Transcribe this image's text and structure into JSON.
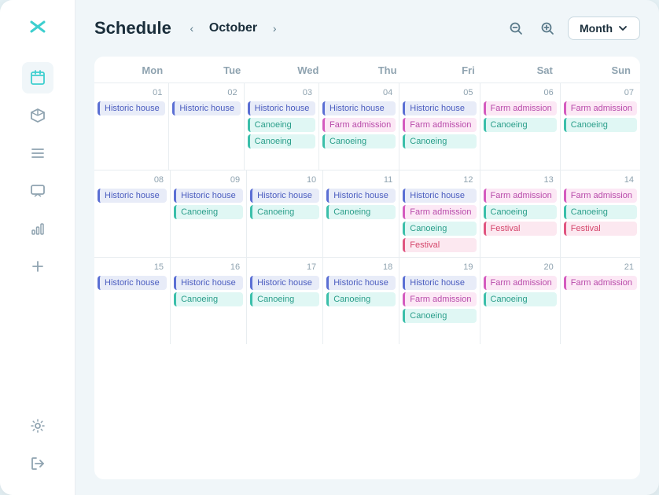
{
  "app": {
    "logo": "✕",
    "title": "Schedule",
    "current_month": "October",
    "view_label": "Month"
  },
  "sidebar": {
    "icons": [
      {
        "name": "calendar-icon",
        "symbol": "📅",
        "active": true
      },
      {
        "name": "box-icon",
        "symbol": "⬡",
        "active": false
      },
      {
        "name": "list-icon",
        "symbol": "≡",
        "active": false
      },
      {
        "name": "chat-icon",
        "symbol": "💬",
        "active": false
      },
      {
        "name": "chart-icon",
        "symbol": "📊",
        "active": false
      },
      {
        "name": "add-icon",
        "symbol": "+",
        "active": false
      }
    ],
    "bottom_icons": [
      {
        "name": "settings-icon",
        "symbol": "⚙"
      },
      {
        "name": "logout-icon",
        "symbol": "→"
      }
    ]
  },
  "calendar": {
    "days_of_week": [
      "Mon",
      "Tue",
      "Wed",
      "Thu",
      "Fri",
      "Sat",
      "Sun"
    ],
    "weeks": [
      {
        "days": [
          {
            "number": "01",
            "events": [
              {
                "type": "historic",
                "label": "Historic house"
              }
            ]
          },
          {
            "number": "02",
            "events": [
              {
                "type": "historic",
                "label": "Historic house"
              }
            ]
          },
          {
            "number": "03",
            "events": [
              {
                "type": "historic",
                "label": "Historic house"
              },
              {
                "type": "canoeing",
                "label": "Canoeing"
              },
              {
                "type": "canoeing",
                "label": "Canoeing"
              }
            ]
          },
          {
            "number": "04",
            "events": [
              {
                "type": "historic",
                "label": "Historic house"
              },
              {
                "type": "farm",
                "label": "Farm admission"
              },
              {
                "type": "canoeing",
                "label": "Canoeing"
              }
            ]
          },
          {
            "number": "05",
            "events": [
              {
                "type": "historic",
                "label": "Historic house"
              },
              {
                "type": "farm",
                "label": "Farm admission"
              },
              {
                "type": "canoeing",
                "label": "Canoeing"
              }
            ]
          },
          {
            "number": "06",
            "events": [
              {
                "type": "farm",
                "label": "Farm admission"
              },
              {
                "type": "canoeing",
                "label": "Canoeing"
              }
            ]
          },
          {
            "number": "07",
            "events": [
              {
                "type": "farm",
                "label": "Farm admission"
              },
              {
                "type": "canoeing",
                "label": "Canoeing"
              }
            ]
          }
        ]
      },
      {
        "days": [
          {
            "number": "08",
            "events": [
              {
                "type": "historic",
                "label": "Historic house"
              }
            ]
          },
          {
            "number": "09",
            "events": [
              {
                "type": "historic",
                "label": "Historic house"
              },
              {
                "type": "canoeing",
                "label": "Canoeing"
              }
            ]
          },
          {
            "number": "10",
            "events": [
              {
                "type": "historic",
                "label": "Historic house"
              },
              {
                "type": "canoeing",
                "label": "Canoeing"
              }
            ]
          },
          {
            "number": "11",
            "events": [
              {
                "type": "historic",
                "label": "Historic house"
              },
              {
                "type": "canoeing",
                "label": "Canoeing"
              }
            ]
          },
          {
            "number": "12",
            "events": [
              {
                "type": "historic",
                "label": "Historic house"
              },
              {
                "type": "farm",
                "label": "Farm admission"
              },
              {
                "type": "canoeing",
                "label": "Canoeing"
              },
              {
                "type": "festival",
                "label": "Festival"
              }
            ]
          },
          {
            "number": "13",
            "events": [
              {
                "type": "farm",
                "label": "Farm admission"
              },
              {
                "type": "canoeing",
                "label": "Canoeing"
              },
              {
                "type": "festival",
                "label": "Festival"
              }
            ]
          },
          {
            "number": "14",
            "events": [
              {
                "type": "farm",
                "label": "Farm admission"
              },
              {
                "type": "canoeing",
                "label": "Canoeing"
              },
              {
                "type": "festival",
                "label": "Festival"
              }
            ]
          }
        ]
      },
      {
        "days": [
          {
            "number": "15",
            "events": [
              {
                "type": "historic",
                "label": "Historic house"
              }
            ]
          },
          {
            "number": "16",
            "events": [
              {
                "type": "historic",
                "label": "Historic house"
              },
              {
                "type": "canoeing",
                "label": "Canoeing"
              }
            ]
          },
          {
            "number": "17",
            "events": [
              {
                "type": "historic",
                "label": "Historic house"
              },
              {
                "type": "canoeing",
                "label": "Canoeing"
              }
            ]
          },
          {
            "number": "18",
            "events": [
              {
                "type": "historic",
                "label": "Historic house"
              },
              {
                "type": "canoeing",
                "label": "Canoeing"
              }
            ]
          },
          {
            "number": "19",
            "events": [
              {
                "type": "historic",
                "label": "Historic house"
              },
              {
                "type": "farm",
                "label": "Farm admission"
              },
              {
                "type": "canoeing",
                "label": "Canoeing"
              }
            ]
          },
          {
            "number": "20",
            "events": [
              {
                "type": "farm",
                "label": "Farm admission"
              },
              {
                "type": "canoeing",
                "label": "Canoeing"
              }
            ]
          },
          {
            "number": "21",
            "events": [
              {
                "type": "farm",
                "label": "Farm admission"
              }
            ]
          }
        ]
      }
    ]
  },
  "event_colors": {
    "historic": "event-historic",
    "farm": "event-farm",
    "canoeing": "event-canoeing",
    "festival": "event-festival"
  }
}
